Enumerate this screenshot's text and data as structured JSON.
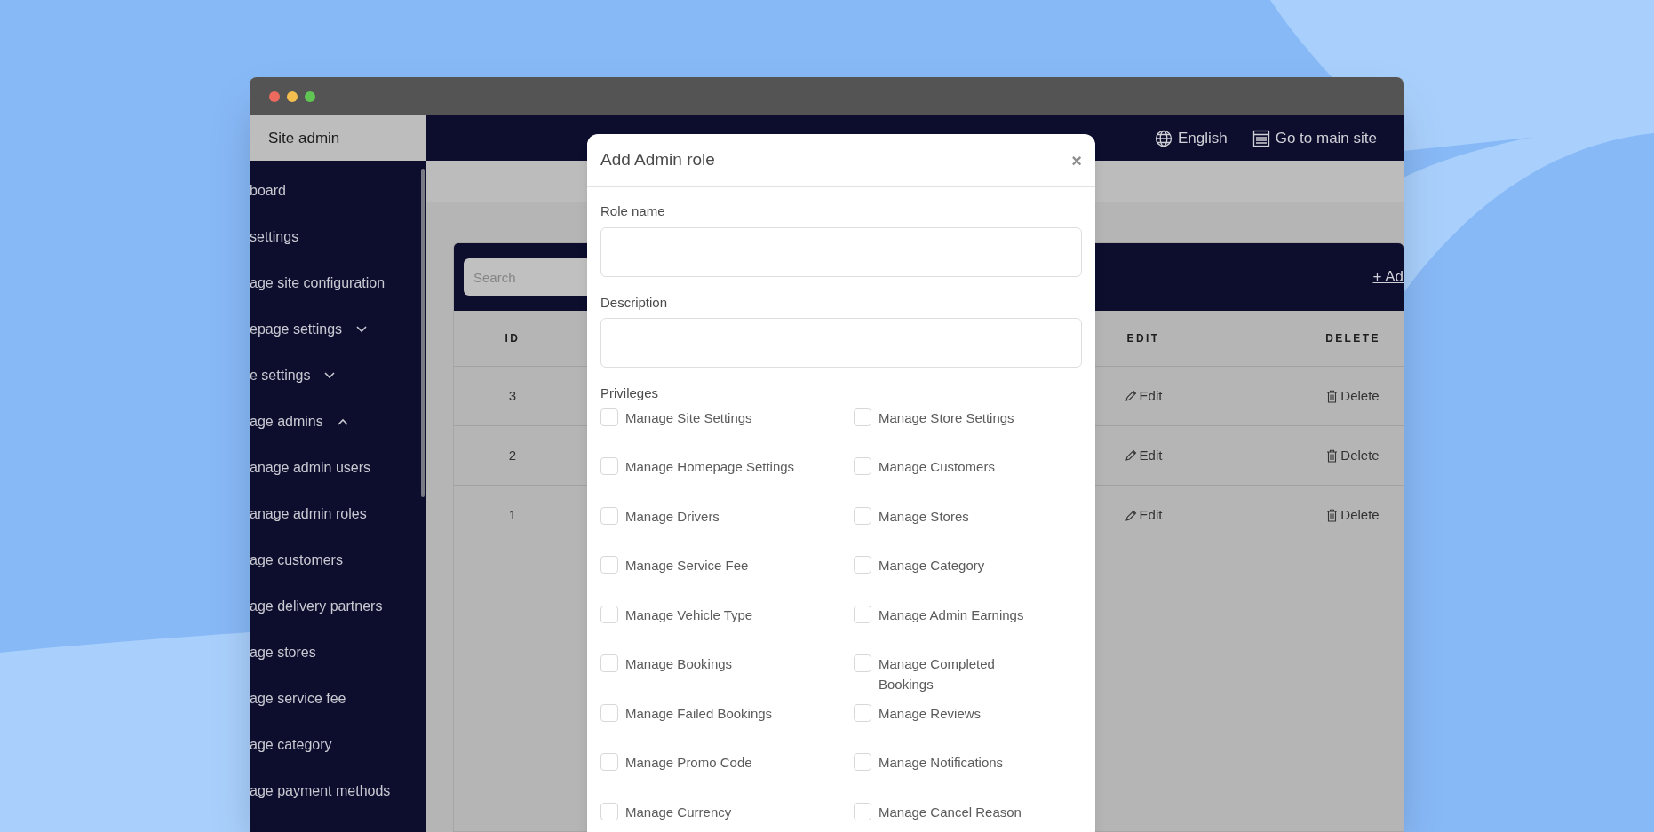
{
  "window": {
    "controls": [
      {
        "color": "#ec6a5e"
      },
      {
        "color": "#f4bf4f"
      },
      {
        "color": "#61c554"
      }
    ]
  },
  "sidebar": {
    "title": "Site admin",
    "items": [
      {
        "label": "board"
      },
      {
        "label": "settings"
      },
      {
        "label": "age site configuration"
      },
      {
        "label": "epage settings",
        "expanded": false
      },
      {
        "label": "e settings",
        "expanded": false
      },
      {
        "label": "age admins",
        "expanded": true,
        "children": [
          {
            "label": "anage admin users"
          },
          {
            "label": "anage admin roles"
          }
        ]
      },
      {
        "label": "age customers"
      },
      {
        "label": "age delivery partners"
      },
      {
        "label": "age stores"
      },
      {
        "label": "age service fee"
      },
      {
        "label": "age category"
      },
      {
        "label": "age payment methods"
      }
    ]
  },
  "top_bar": {
    "language": "English",
    "main_site_link": "Go to main site"
  },
  "table": {
    "search": {
      "placeholder": "Search"
    },
    "add_link": "+ Ad",
    "columns": [
      "ID",
      "EDIT",
      "DELETE"
    ],
    "rows": [
      {
        "id": "3",
        "edit": "Edit",
        "delete": "Delete"
      },
      {
        "id": "2",
        "edit": "Edit",
        "delete": "Delete"
      },
      {
        "id": "1",
        "edit": "Edit",
        "delete": "Delete"
      }
    ]
  },
  "modal": {
    "title": "Add Admin role",
    "close": "×",
    "fields": [
      {
        "label": "Role name"
      },
      {
        "label": "Description"
      }
    ],
    "privileges_label": "Privileges",
    "privileges": [
      {
        "label": "Manage Site Settings",
        "checked": false
      },
      {
        "label": "Manage Store Settings",
        "checked": false
      },
      {
        "label": "Manage Homepage Settings",
        "checked": false
      },
      {
        "label": "Manage Customers",
        "checked": false
      },
      {
        "label": "Manage Drivers",
        "checked": false
      },
      {
        "label": "Manage Stores",
        "checked": false
      },
      {
        "label": "Manage Service Fee",
        "checked": false
      },
      {
        "label": "Manage Category",
        "checked": false
      },
      {
        "label": "Manage Vehicle Type",
        "checked": false
      },
      {
        "label": "Manage Admin Earnings",
        "checked": false
      },
      {
        "label": "Manage Bookings",
        "checked": false
      },
      {
        "label": "Manage Completed Bookings",
        "checked": false
      },
      {
        "label": "Manage Failed Bookings",
        "checked": false
      },
      {
        "label": "Manage Reviews",
        "checked": false
      },
      {
        "label": "Manage Promo Code",
        "checked": false
      },
      {
        "label": "Manage Notifications",
        "checked": false
      },
      {
        "label": "Manage Currency",
        "checked": false
      },
      {
        "label": "Manage Cancel Reason",
        "checked": false
      }
    ]
  }
}
